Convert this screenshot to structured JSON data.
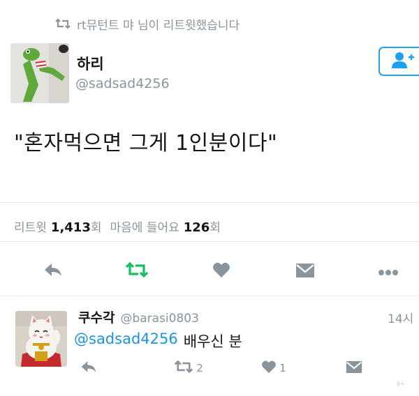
{
  "retweet_context": {
    "icon": "retweet-icon",
    "text": "rt뮤턴트 먀 님이 리트윗했습니다"
  },
  "tweet": {
    "author_name": "하리",
    "author_handle": "@sadsad4256",
    "text": "\"혼자먹으면 그게 1인분이다\"",
    "stats": {
      "retweets_label": "리트윗",
      "retweets_count": "1,413",
      "retweets_unit": "회",
      "likes_label": "마음에 들어요",
      "likes_count": "126",
      "likes_unit": "회"
    },
    "actions": [
      "reply-icon",
      "retweet-icon",
      "heart-icon",
      "dm-icon",
      "more-icon"
    ]
  },
  "reply": {
    "author_name": "쿠수각",
    "author_handle": "@barasi0803",
    "time": "14시",
    "mention": "@sadsad4256",
    "text": "배우신 분",
    "retweet_count": "2",
    "like_count": "1"
  },
  "colors": {
    "accent": "#1da1f2",
    "mention": "#1b95e0",
    "retweet_active": "#17bf63",
    "icon_gray": "#8a949c",
    "divider": "#e6ecf0"
  },
  "watermark": "ä+"
}
